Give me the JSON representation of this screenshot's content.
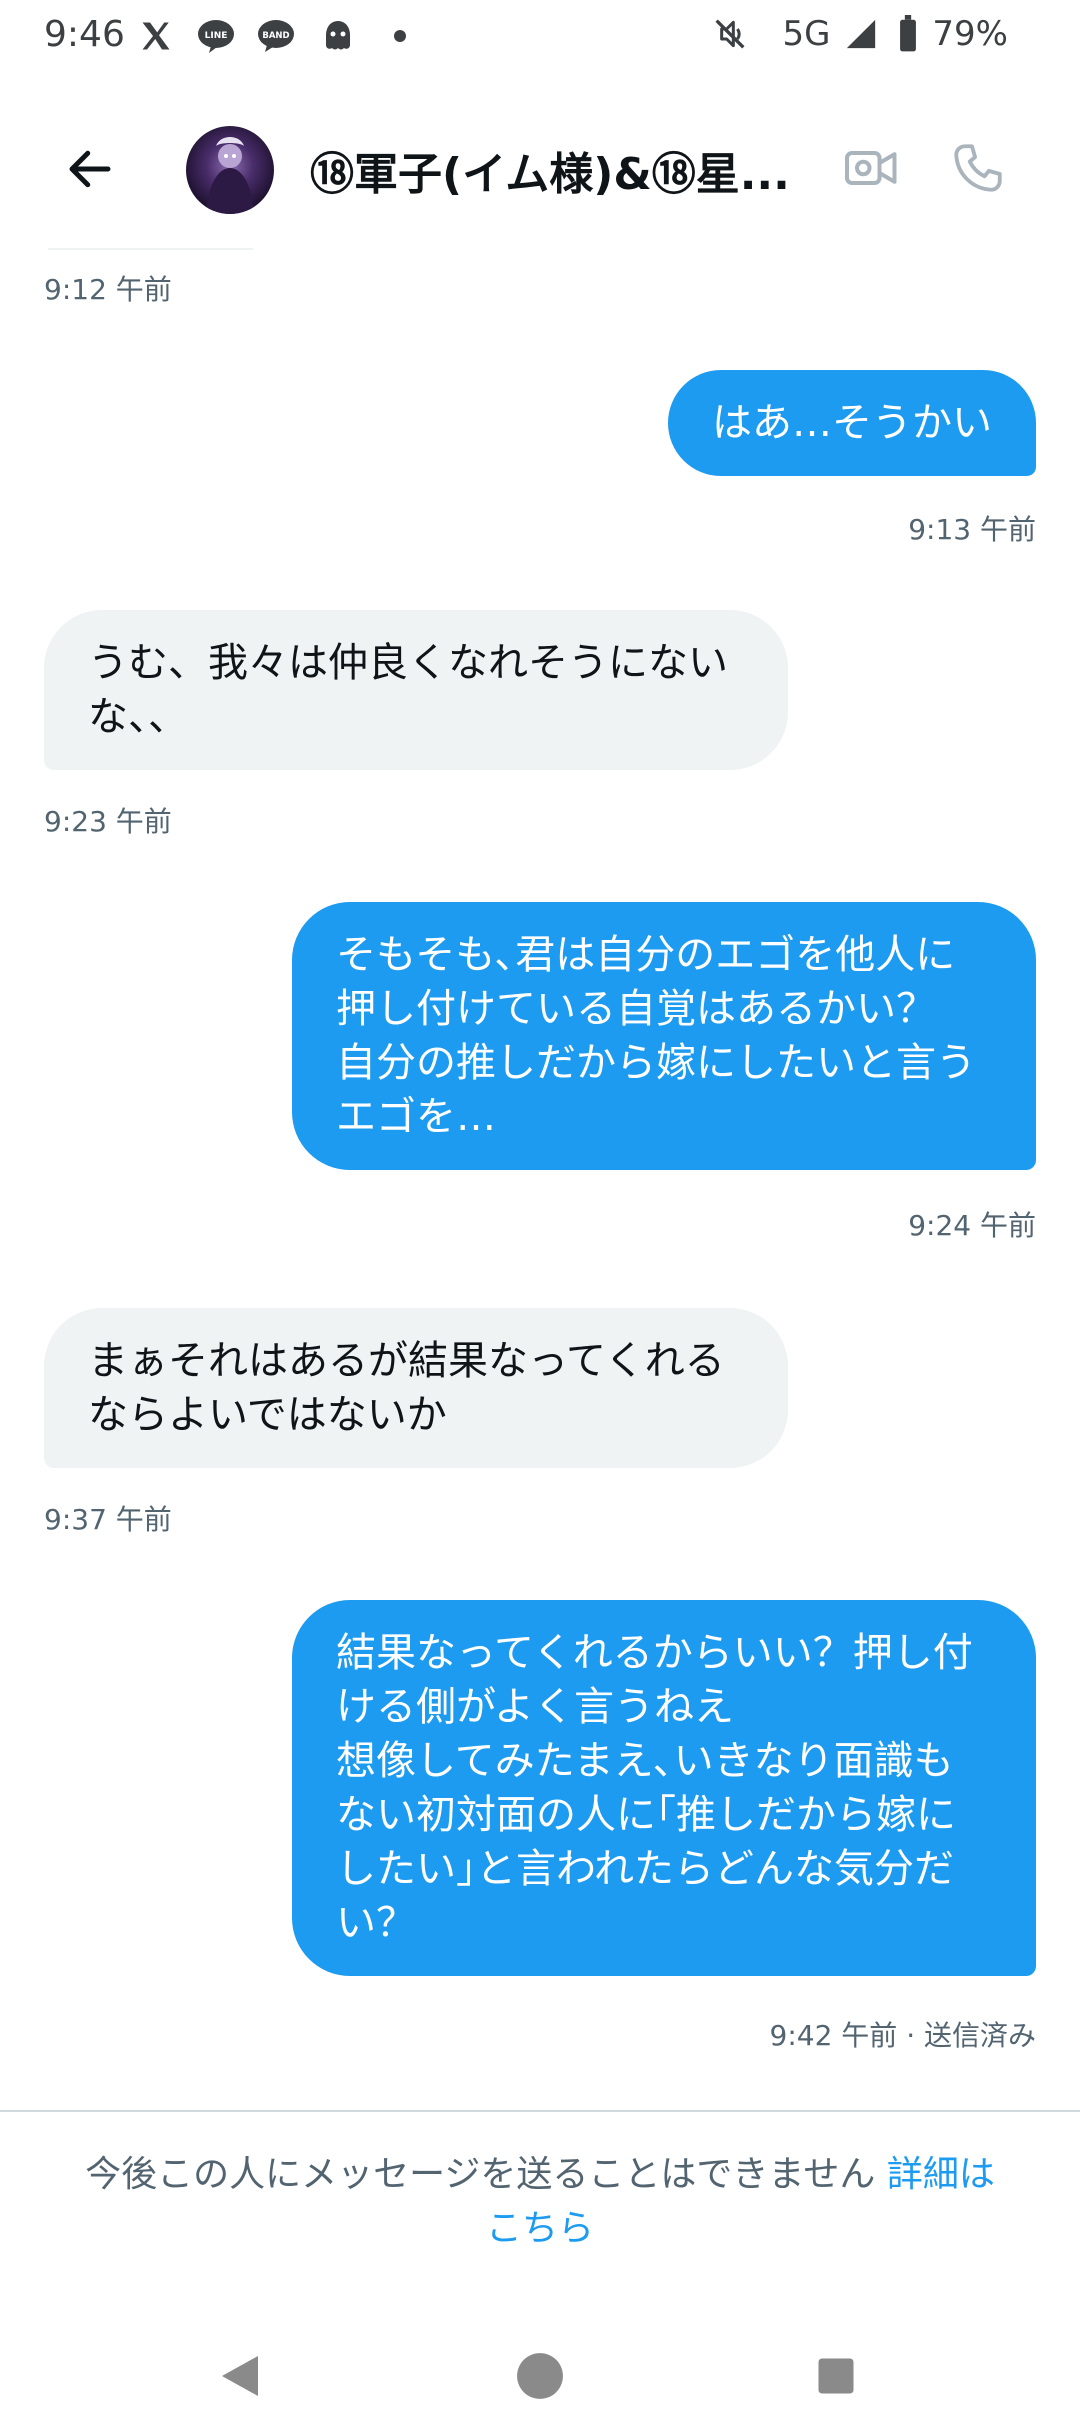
{
  "status_bar": {
    "time": "9:46",
    "network": "5G",
    "battery": "79%",
    "icons": [
      "x-logo-icon",
      "line-app-icon",
      "band-app-icon",
      "ghost-app-icon",
      "dot-icon",
      "mute-icon",
      "signal-icon",
      "battery-icon"
    ]
  },
  "header": {
    "title": "⑱軍子(イム様)&⑱星...",
    "back_icon": "back-arrow-icon",
    "video_icon": "video-call-icon",
    "call_icon": "phone-icon"
  },
  "messages": [
    {
      "direction": "received",
      "lines": [],
      "time": "9:12 午前"
    },
    {
      "direction": "sent",
      "lines": [
        "はあ…そうかい"
      ],
      "time": "9:13 午前"
    },
    {
      "direction": "received",
      "lines": [
        "うむ、我々は仲良くなれそうにない",
        "な、、"
      ],
      "time": "9:23 午前"
    },
    {
      "direction": "sent",
      "lines": [
        "そもそも､君は自分のエゴを他人に",
        "押し付けている自覚はあるかい？",
        "自分の推しだから嫁にしたいと言う",
        "エゴを…"
      ],
      "time": "9:24 午前"
    },
    {
      "direction": "received",
      "lines": [
        "まぁそれはあるが結果なってくれる",
        "ならよいではないか"
      ],
      "time": "9:37 午前"
    },
    {
      "direction": "sent",
      "lines": [
        "結果なってくれるからいい？押し付",
        "ける側がよく言うねえ",
        "想像してみたまえ､いきなり面識も",
        "ない初対面の人に｢推しだから嫁に",
        "したい｣と言われたらどんな気分だ",
        "い？"
      ],
      "time": "9:42 午前 · 送信済み"
    }
  ],
  "notice": {
    "text": "今後この人にメッセージを送ることはできません",
    "link_line1": "詳細は",
    "link_line2": "こちら"
  },
  "nav": {
    "icons": [
      "nav-back-icon",
      "nav-home-icon",
      "nav-recents-icon"
    ]
  },
  "colors": {
    "sent_bubble": "#1d9bf0",
    "received_bubble": "#eff3f4",
    "timestamp": "#536471",
    "link": "#1d9bf0"
  }
}
